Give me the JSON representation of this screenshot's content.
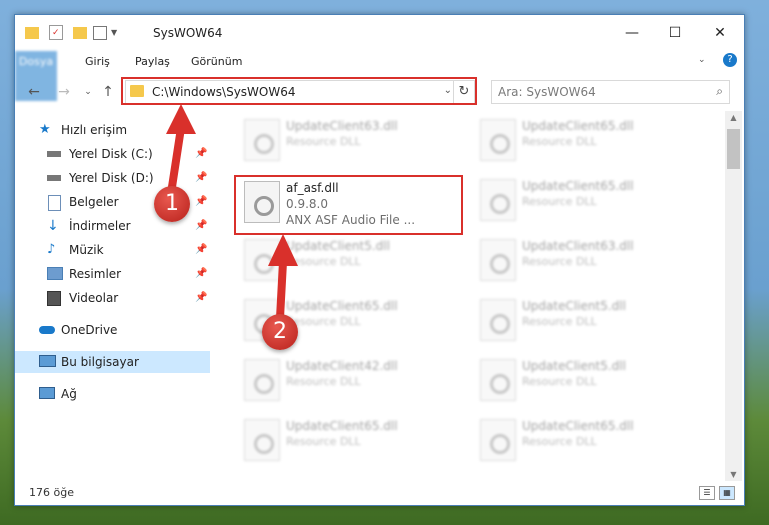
{
  "window": {
    "title": "SysWOW64"
  },
  "ribbon": {
    "tabs": [
      "Dosya",
      "Giriş",
      "Paylaş",
      "Görünüm"
    ]
  },
  "address": {
    "path": "C:\\Windows\\SysWOW64"
  },
  "search": {
    "placeholder": "Ara: SysWOW64"
  },
  "sidebar": {
    "items": [
      {
        "label": "Hızlı erişim",
        "icon": "star-icon",
        "pinned": false
      },
      {
        "label": "Yerel Disk (C:)",
        "icon": "drive-icon",
        "pinned": true
      },
      {
        "label": "Yerel Disk (D:)",
        "icon": "drive-icon",
        "pinned": true
      },
      {
        "label": "Belgeler",
        "icon": "documents-icon",
        "pinned": true
      },
      {
        "label": "İndirmeler",
        "icon": "download-icon",
        "pinned": true
      },
      {
        "label": "Müzik",
        "icon": "music-icon",
        "pinned": true
      },
      {
        "label": "Resimler",
        "icon": "pictures-icon",
        "pinned": true
      },
      {
        "label": "Videolar",
        "icon": "videos-icon",
        "pinned": true
      },
      {
        "label": "OneDrive",
        "icon": "cloud-icon",
        "pinned": false
      },
      {
        "label": "Bu bilgisayar",
        "icon": "computer-icon",
        "pinned": false,
        "selected": true
      },
      {
        "label": "Ağ",
        "icon": "network-icon",
        "pinned": false
      }
    ]
  },
  "files": {
    "highlighted": {
      "name": "af_asf.dll",
      "version": "0.9.8.0",
      "description": "ANX ASF Audio File ..."
    },
    "left": [
      {
        "name": "UpdateClient63.dll",
        "desc": "Resource DLL"
      },
      {
        "name": "UpdateClient5.dll",
        "desc": "Resource DLL"
      },
      {
        "name": "UpdateClient65.dll",
        "desc": "Resource DLL"
      },
      {
        "name": "UpdateClient42.dll",
        "desc": "Resource DLL"
      },
      {
        "name": "UpdateClient65.dll",
        "desc": "Resource DLL"
      }
    ],
    "right": [
      {
        "name": "UpdateClient65.dll",
        "desc": "Resource DLL"
      },
      {
        "name": "UpdateClient65.dll",
        "desc": "Resource DLL"
      },
      {
        "name": "UpdateClient63.dll",
        "desc": "Resource DLL"
      },
      {
        "name": "UpdateClient5.dll",
        "desc": "Resource DLL"
      },
      {
        "name": "UpdateClient5.dll",
        "desc": "Resource DLL"
      },
      {
        "name": "UpdateClient65.dll",
        "desc": "Resource DLL"
      }
    ]
  },
  "status": {
    "count": "176 öğe"
  },
  "annotations": {
    "marker1": "1",
    "marker2": "2"
  },
  "colors": {
    "accent": "#1979ca",
    "highlight": "#d9302b",
    "selected": "#cce8ff"
  }
}
